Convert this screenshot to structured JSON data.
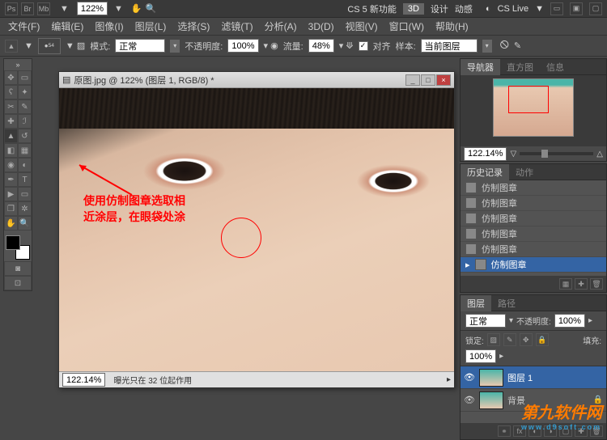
{
  "top_icons": {
    "labels": [
      "Ps",
      "Br",
      "Mb"
    ],
    "zoom": "122%",
    "cs_label": "CS 5 新功能",
    "tabs": [
      "3D",
      "设计",
      "动感"
    ],
    "cslive": "CS Live"
  },
  "menu": {
    "items": [
      "文件(F)",
      "编辑(E)",
      "图像(I)",
      "图层(L)",
      "选择(S)",
      "滤镜(T)",
      "分析(A)",
      "3D(D)",
      "视图(V)",
      "窗口(W)",
      "帮助(H)"
    ]
  },
  "options": {
    "brush_size": "54",
    "mode_label": "模式:",
    "mode_value": "正常",
    "opacity_label": "不透明度:",
    "opacity_value": "100%",
    "flow_label": "流量:",
    "flow_value": "48%",
    "aligned_label": "对齐",
    "sample_label": "样本:",
    "sample_value": "当前图层"
  },
  "doc": {
    "title": "原图.jpg @ 122% (图层 1, RGB/8) *",
    "status_zoom": "122.14%",
    "status_text": "曝光只在 32 位起作用"
  },
  "annotation": {
    "line1": "使用仿制图章选取相",
    "line2": "近涂层，在眼袋处涂"
  },
  "navigator": {
    "tabs": [
      "导航器",
      "直方图",
      "信息"
    ],
    "zoom": "122.14%"
  },
  "history": {
    "tabs": [
      "历史记录",
      "动作"
    ],
    "items": [
      "仿制图章",
      "仿制图章",
      "仿制图章",
      "仿制图章",
      "仿制图章",
      "仿制图章"
    ]
  },
  "layers": {
    "tabs": [
      "图层",
      "路径"
    ],
    "mode": "正常",
    "opacity_label": "不透明度:",
    "opacity": "100%",
    "lock_label": "锁定:",
    "fill_label": "填充:",
    "fill": "100%",
    "items": [
      {
        "name": "图层 1"
      },
      {
        "name": "背景"
      }
    ]
  },
  "watermark": {
    "main": "第九软件网",
    "url": "www.d9soft.com"
  }
}
